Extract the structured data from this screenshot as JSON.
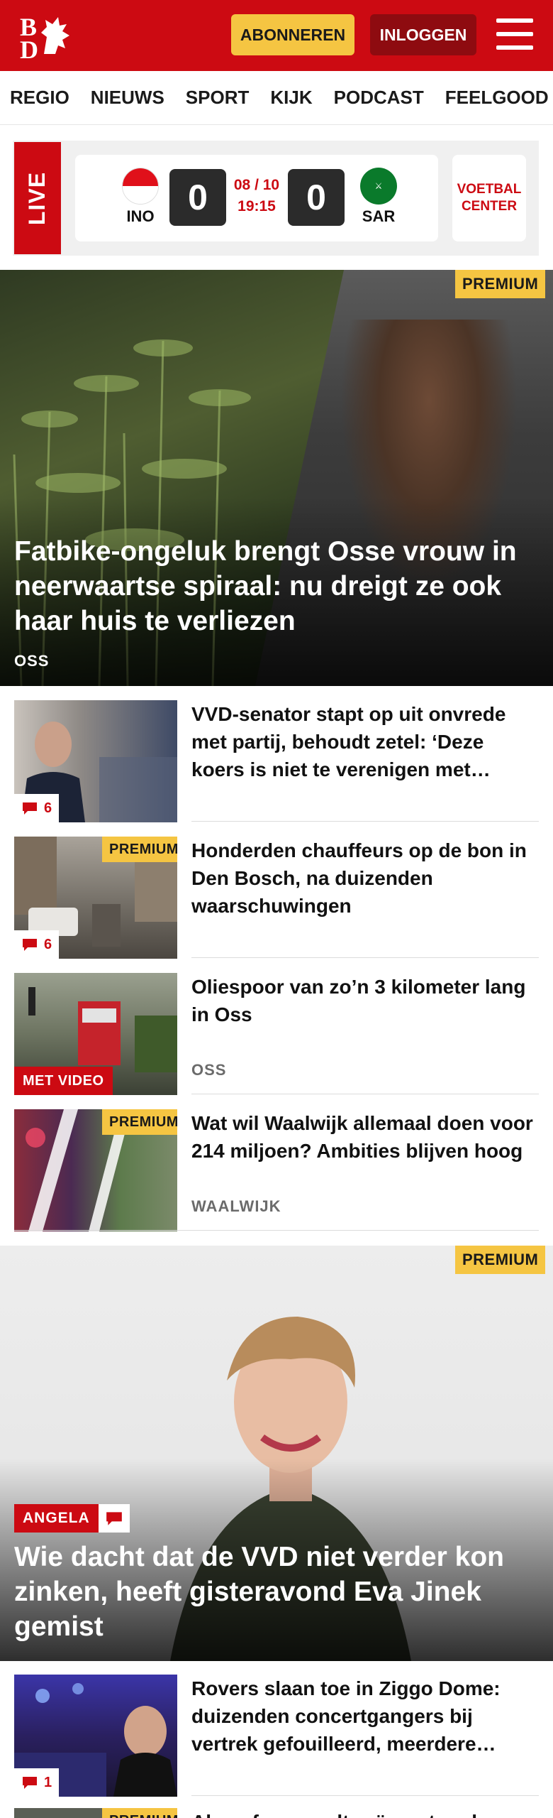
{
  "header": {
    "logo_text": "BD",
    "subscribe_label": "ABONNEREN",
    "login_label": "INLOGGEN",
    "brand_color": "#cc0a12"
  },
  "nav": {
    "items": [
      "REGIO",
      "NIEUWS",
      "SPORT",
      "KIJK",
      "PODCAST",
      "FEELGOOD"
    ]
  },
  "live": {
    "label": "LIVE",
    "home_code": "INO",
    "away_code": "SAR",
    "home_score": "0",
    "away_score": "0",
    "date": "08 / 10",
    "time": "19:15",
    "center_label_1": "VOETBAL",
    "center_label_2": "CENTER"
  },
  "hero": {
    "badge": "PREMIUM",
    "title": "Fatbike-ongeluk brengt Osse vrouw in neerwaartse spiraal: nu dreigt ze ook haar huis te verliezen",
    "location": "OSS"
  },
  "articles": [
    {
      "title": "VVD-senator stapt op uit onvrede met partij, behoudt zetel: ‘Deze koers is niet te verenigen met…",
      "comments": "6"
    },
    {
      "badge": "PREMIUM",
      "title": "Honderden chauffeurs op de bon in Den Bosch, na duizenden waarschuwingen",
      "comments": "6"
    },
    {
      "video_label": "MET VIDEO",
      "title": "Oliespoor van zo’n 3 kilometer lang in Oss",
      "location": "OSS"
    },
    {
      "badge": "PREMIUM",
      "title": "Wat wil Waalwijk allemaal doen voor 214 miljoen? Ambities blijven hoog",
      "location": "WAALWIJK"
    }
  ],
  "feature": {
    "badge": "PREMIUM",
    "author": "ANGELA",
    "title": "Wie dacht dat de VVD niet verder kon zinken, heeft gisteravond Eva Jinek gemist"
  },
  "bottom_article": {
    "title": "Rovers slaan toe in Ziggo Dome: duizenden concertgangers bij vertrek gefouilleerd, meerdere…",
    "comments": "1",
    "badge": "PREMIUM",
    "teaser": "Als er fors wordt geïnvesteerd"
  }
}
